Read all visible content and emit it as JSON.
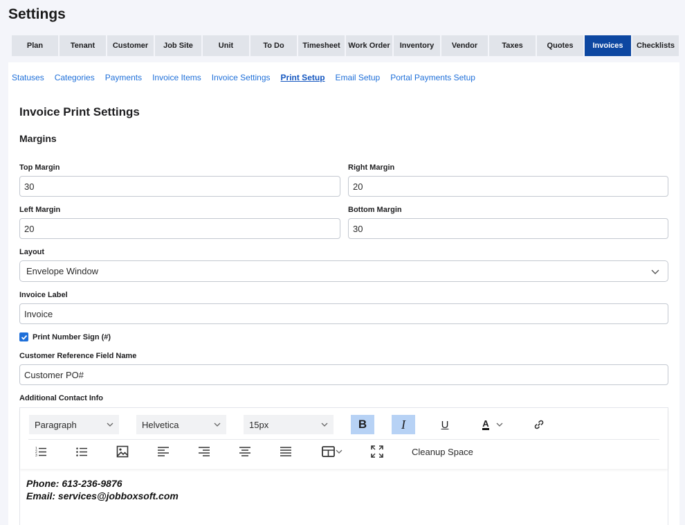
{
  "page": {
    "title": "Settings"
  },
  "tabs": [
    {
      "label": "Plan",
      "active": false
    },
    {
      "label": "Tenant",
      "active": false
    },
    {
      "label": "Customer",
      "active": false
    },
    {
      "label": "Job Site",
      "active": false
    },
    {
      "label": "Unit",
      "active": false
    },
    {
      "label": "To Do",
      "active": false
    },
    {
      "label": "Timesheet",
      "active": false
    },
    {
      "label": "Work Order",
      "active": false
    },
    {
      "label": "Inventory",
      "active": false
    },
    {
      "label": "Vendor",
      "active": false
    },
    {
      "label": "Taxes",
      "active": false
    },
    {
      "label": "Quotes",
      "active": false
    },
    {
      "label": "Invoices",
      "active": true
    },
    {
      "label": "Checklists",
      "active": false
    }
  ],
  "subnav": [
    {
      "label": "Statuses",
      "active": false
    },
    {
      "label": "Categories",
      "active": false
    },
    {
      "label": "Payments",
      "active": false
    },
    {
      "label": "Invoice Items",
      "active": false
    },
    {
      "label": "Invoice Settings",
      "active": false
    },
    {
      "label": "Print Setup",
      "active": true
    },
    {
      "label": "Email Setup",
      "active": false
    },
    {
      "label": "Portal Payments Setup",
      "active": false
    }
  ],
  "form": {
    "heading": "Invoice Print Settings",
    "margins_heading": "Margins",
    "top_margin": {
      "label": "Top Margin",
      "value": "30"
    },
    "right_margin": {
      "label": "Right Margin",
      "value": "20"
    },
    "left_margin": {
      "label": "Left Margin",
      "value": "20"
    },
    "bottom_margin": {
      "label": "Bottom Margin",
      "value": "30"
    },
    "layout": {
      "label": "Layout",
      "value": "Envelope Window"
    },
    "invoice_label": {
      "label": "Invoice Label",
      "value": "Invoice"
    },
    "print_number_sign": {
      "label": "Print Number Sign (#)",
      "checked": true
    },
    "customer_ref": {
      "label": "Customer Reference Field Name",
      "value": "Customer PO#"
    },
    "additional_contact": {
      "label": "Additional Contact Info"
    }
  },
  "editor": {
    "block_format": "Paragraph",
    "font_family": "Helvetica",
    "font_size": "15px",
    "bold_label": "B",
    "italic_label": "I",
    "underline_label": "U",
    "font_color_label": "A",
    "cleanup_label": "Cleanup Space",
    "content_lines": [
      "Phone: 613-236-9876",
      "Email: services@jobboxsoft.com"
    ]
  },
  "colors": {
    "accent": "#0d47a1",
    "link": "#1e6fd9",
    "toggle_on": "#b7d2f5"
  }
}
